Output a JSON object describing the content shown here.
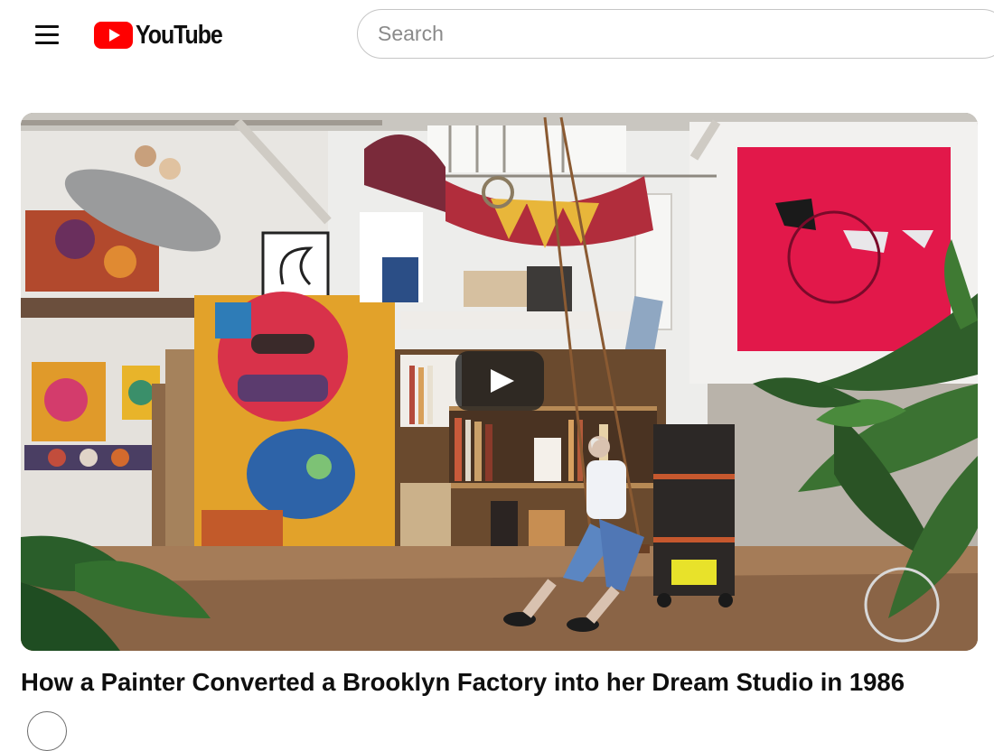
{
  "header": {
    "logo_text": "YouTube",
    "search": {
      "placeholder": "Search",
      "value": ""
    }
  },
  "video": {
    "title": "How a Painter Converted a Brooklyn Factory into her Dream Studio in 1986"
  },
  "colors": {
    "brand_red": "#ff0000",
    "text_primary": "#0f0f0f",
    "search_border": "#c6c6c6"
  },
  "icons": {
    "menu": "menu-icon",
    "play": "play-icon"
  }
}
